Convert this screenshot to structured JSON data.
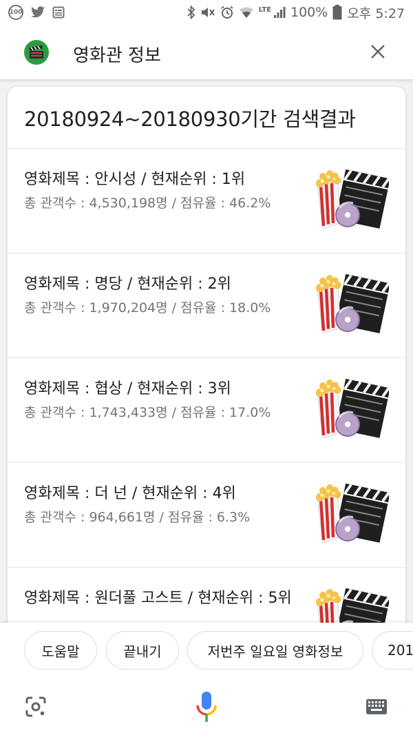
{
  "status_bar": {
    "notification_badge": "100",
    "battery": "100%",
    "time": "오후 5:27",
    "network": "LTE",
    "icons": [
      "twitter-icon",
      "news-icon",
      "bluetooth-icon",
      "mute-icon",
      "alarm-icon",
      "wifi-icon",
      "signal-icon",
      "battery-icon"
    ]
  },
  "header": {
    "title": "영화관 정보",
    "icon": "movie-clapper-icon",
    "close_icon": "close-icon"
  },
  "card": {
    "title": "20180924~20180930기간 검색결과",
    "items": [
      {
        "title": "영화제목 : 안시성 / 현재순위 : 1위",
        "sub": "총 관객수 : 4,530,198명 / 점유율 : 46.2%",
        "thumb": "movie-popcorn-thumbnail"
      },
      {
        "title": "영화제목 : 명당 / 현재순위 : 2위",
        "sub": "총 관객수 : 1,970,204명 / 점유율 : 18.0%",
        "thumb": "movie-popcorn-thumbnail"
      },
      {
        "title": "영화제목 : 협상 / 현재순위 : 3위",
        "sub": "총 관객수 : 1,743,433명 / 점유율 : 17.0%",
        "thumb": "movie-popcorn-thumbnail"
      },
      {
        "title": "영화제목 : 더 넌 / 현재순위 : 4위",
        "sub": "총 관객수 : 964,661명 / 점유율 : 6.3%",
        "thumb": "movie-popcorn-thumbnail"
      },
      {
        "title": "영화제목 : 원더풀 고스트 / 현재순위 : 5위",
        "sub": "",
        "thumb": "movie-popcorn-thumbnail"
      }
    ]
  },
  "chips": [
    {
      "label": "도움말"
    },
    {
      "label": "끝내기"
    },
    {
      "label": "저번주 일요일 영화정보"
    },
    {
      "label": "201"
    }
  ],
  "bottom_bar": {
    "lens_icon": "lens-icon",
    "mic_icon": "mic-icon",
    "keyboard_icon": "keyboard-icon"
  },
  "colors": {
    "accent_green": "#2a9d3e",
    "mic_blue": "#4285f4",
    "mic_red": "#ea4335",
    "mic_yellow": "#fbbc04",
    "mic_green": "#34a853"
  }
}
